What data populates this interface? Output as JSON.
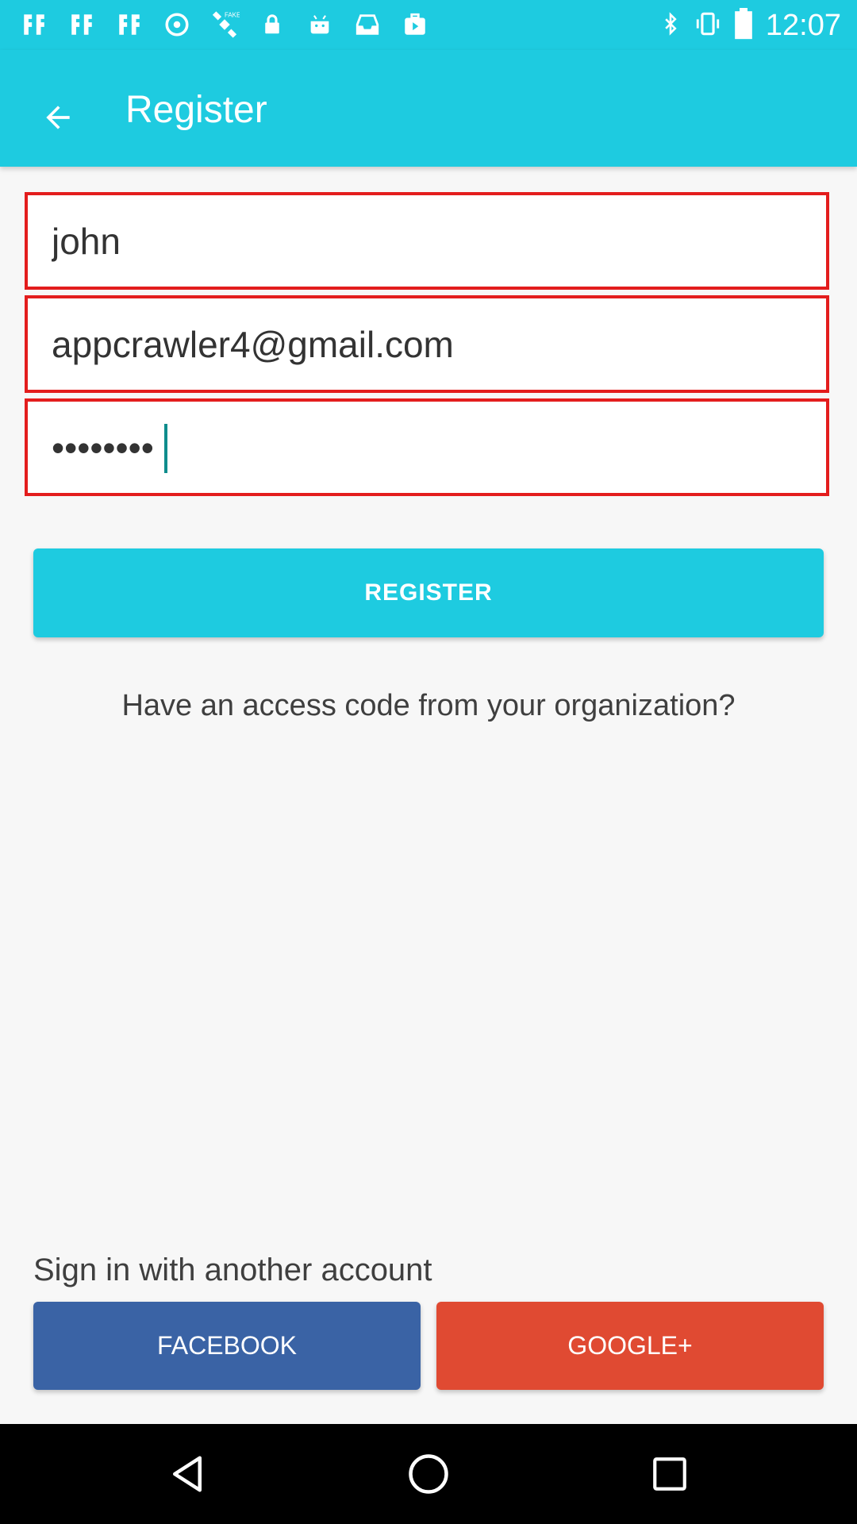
{
  "status_bar": {
    "time": "12:07",
    "icons_left": [
      "fake-gps-icon",
      "fake-gps-icon",
      "fake-gps-icon",
      "sync-icon",
      "satellite-fake-icon",
      "lock-icon",
      "android-icon",
      "inbox-icon",
      "play-store-icon"
    ],
    "icons_right": [
      "bluetooth-icon",
      "vibrate-icon",
      "battery-icon"
    ]
  },
  "app_bar": {
    "title": "Register"
  },
  "form": {
    "name_value": "john",
    "email_value": "appcrawler4@gmail.com",
    "password_value": "••••••••"
  },
  "register_button": "REGISTER",
  "access_code_link": "Have an access code from your organization?",
  "social": {
    "label": "Sign in with another account",
    "facebook": "FACEBOOK",
    "google": "GOOGLE+"
  },
  "colors": {
    "primary": "#1ecbe0",
    "field_border": "#e31d1d",
    "facebook": "#3a63a5",
    "google": "#e04a32"
  }
}
